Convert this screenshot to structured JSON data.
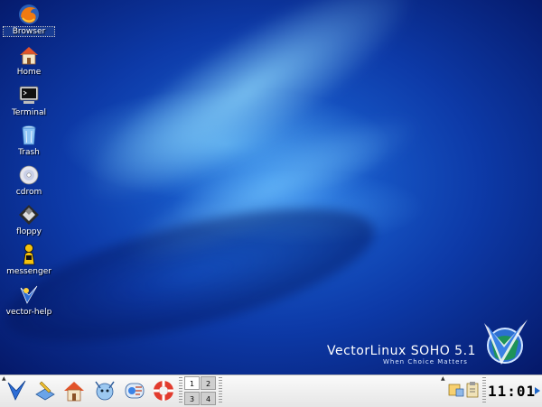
{
  "desktop": {
    "icons": [
      {
        "label": "Browser",
        "icon": "firefox-icon"
      },
      {
        "label": "Home",
        "icon": "home-icon"
      },
      {
        "label": "Terminal",
        "icon": "terminal-icon"
      },
      {
        "label": "Trash",
        "icon": "trash-icon"
      },
      {
        "label": "cdrom",
        "icon": "cdrom-icon"
      },
      {
        "label": "floppy",
        "icon": "floppy-icon"
      },
      {
        "label": "messenger",
        "icon": "messenger-icon"
      },
      {
        "label": "vector-help",
        "icon": "vector-help-icon"
      }
    ],
    "branding": {
      "name": "VectorLinux SOHO 5.1",
      "tagline": "When Choice Matters"
    }
  },
  "taskbar": {
    "launchers": [
      "vector-menu-icon",
      "editor-icon",
      "home-icon",
      "kde-help-icon",
      "messenger-icon",
      "lifebuoy-icon"
    ],
    "pager": [
      "1",
      "2",
      "3",
      "4"
    ],
    "active_desktop": "1",
    "tray": [
      "network-icon",
      "clipboard-icon"
    ],
    "clock": "11:01"
  },
  "colors": {
    "accent": "#1f66c8",
    "wallpaper_dark": "#05196a",
    "wallpaper_light": "#78d2ff"
  }
}
